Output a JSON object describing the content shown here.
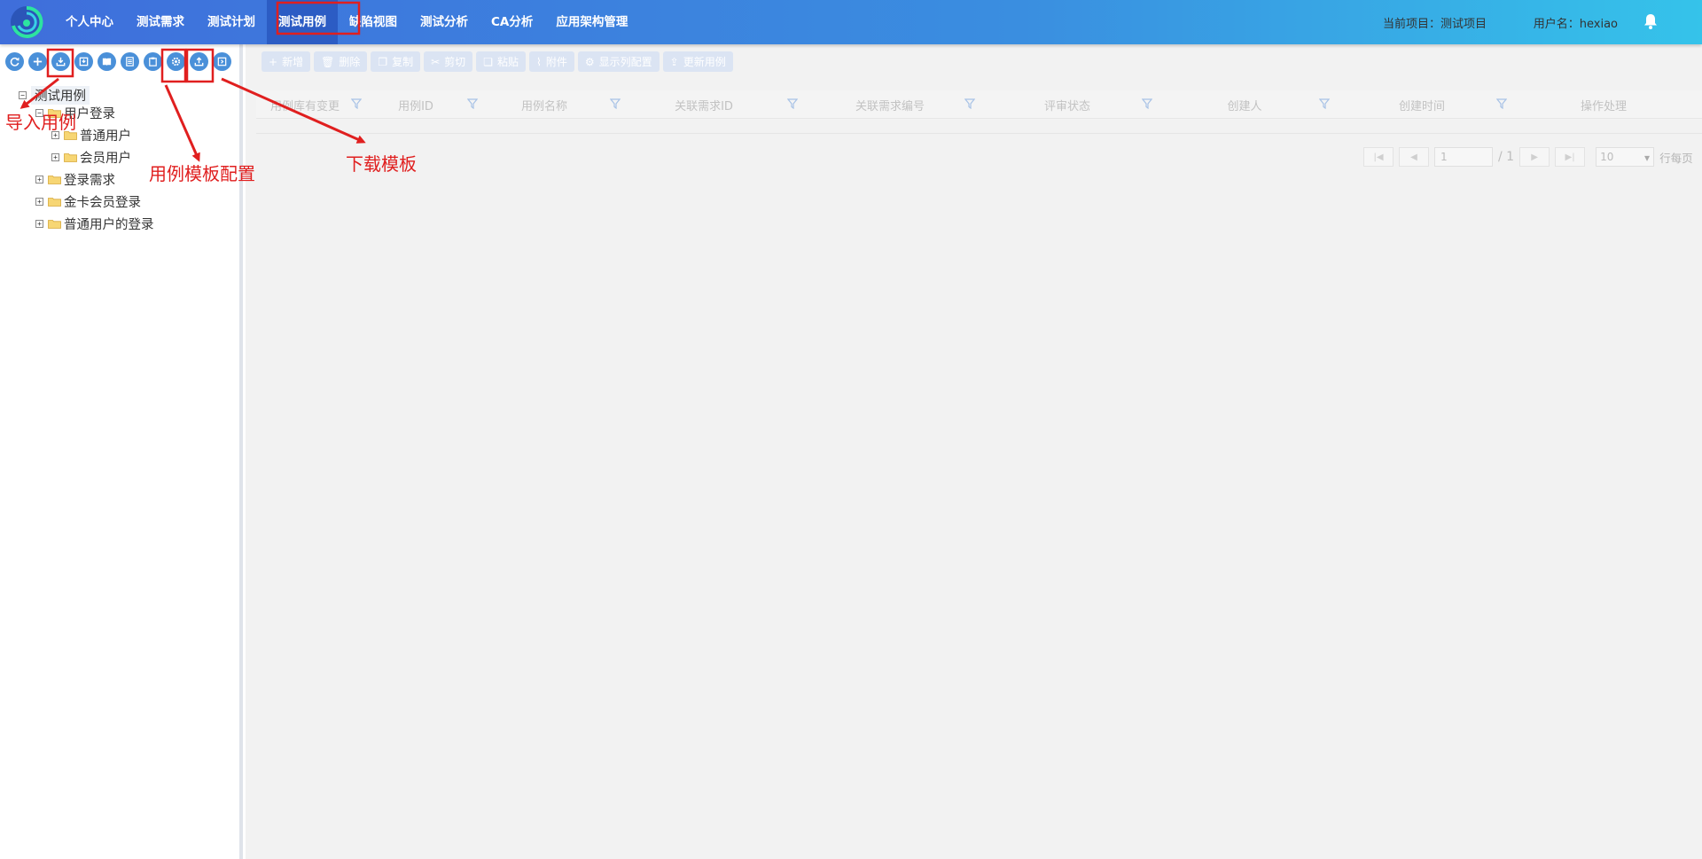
{
  "header": {
    "nav": [
      {
        "label": "个人中心"
      },
      {
        "label": "测试需求"
      },
      {
        "label": "测试计划"
      },
      {
        "label": "测试用例"
      },
      {
        "label": "缺陷视图"
      },
      {
        "label": "测试分析"
      },
      {
        "label": "CA分析"
      },
      {
        "label": "应用架构管理"
      }
    ],
    "active_tab": "测试用例",
    "current_project": "当前项目：测试项目",
    "username": "用户名：hexiao"
  },
  "tree_toolbar": {
    "icons": [
      "refresh-icon",
      "add-icon",
      "import-icon",
      "export-icon",
      "book-icon",
      "list-icon",
      "paste-icon",
      "settings-icon",
      "upload-icon",
      "collapse-icon"
    ]
  },
  "tree": {
    "root": "测试用例",
    "nodes": [
      {
        "label": "用户登录",
        "level": 1,
        "expanded": true
      },
      {
        "label": "普通用户",
        "level": 2,
        "expanded": false
      },
      {
        "label": "会员用户",
        "level": 2,
        "expanded": false
      },
      {
        "label": "登录需求",
        "level": 1,
        "expanded": false
      },
      {
        "label": "金卡会员登录",
        "level": 1,
        "expanded": false
      },
      {
        "label": "普通用户的登录",
        "level": 1,
        "expanded": false
      }
    ]
  },
  "main_toolbar": {
    "buttons": [
      {
        "label": "新增",
        "icon": "plus-icon"
      },
      {
        "label": "删除",
        "icon": "trash-icon"
      },
      {
        "label": "复制",
        "icon": "copy-icon"
      },
      {
        "label": "剪切",
        "icon": "scissors-icon"
      },
      {
        "label": "粘贴",
        "icon": "paste-icon"
      },
      {
        "label": "附件",
        "icon": "attachment-icon"
      },
      {
        "label": "显示列配置",
        "icon": "gear-icon"
      },
      {
        "label": "更新用例",
        "icon": "upload-icon"
      }
    ]
  },
  "grid": {
    "columns": [
      "用例库有变更",
      "用例ID",
      "用例名称",
      "关联需求ID",
      "关联需求编号",
      "评审状态",
      "创建人",
      "创建时间",
      "操作处理"
    ]
  },
  "pager": {
    "page": "1",
    "total": "/ 1",
    "page_size": "10",
    "per_page_label": "行每页"
  },
  "annotations": {
    "import": "导入用例",
    "template_config": "用例模板配置",
    "download_template": "下载模板"
  },
  "colors": {
    "header_start": "#3f6edb",
    "header_end": "#35c3ea",
    "active_tab": "#2c5cc4",
    "toolbar_icon": "#4a90d9",
    "annotation": "#e01f1f"
  }
}
